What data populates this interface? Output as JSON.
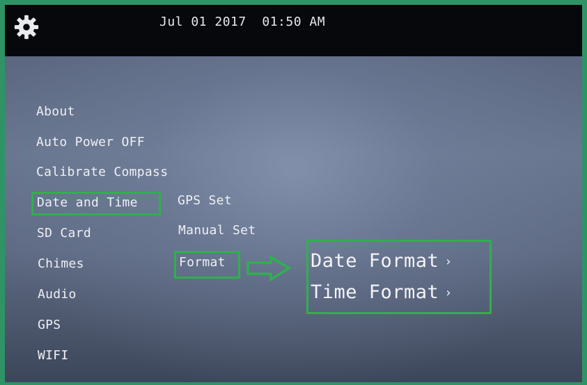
{
  "header": {
    "settings_icon": "gear-icon",
    "datetime": "Jul 01 2017  01:50 AM"
  },
  "menu": {
    "items": [
      {
        "label": "About"
      },
      {
        "label": "Auto Power OFF"
      },
      {
        "label": "Calibrate Compass"
      },
      {
        "label": "Date and Time",
        "highlighted": true
      },
      {
        "label": "SD Card"
      },
      {
        "label": "Chimes"
      },
      {
        "label": "Audio"
      },
      {
        "label": "GPS"
      },
      {
        "label": "WIFI"
      }
    ]
  },
  "submenu": {
    "items": [
      {
        "label": "GPS Set"
      },
      {
        "label": "Manual Set"
      },
      {
        "label": "Format",
        "highlighted": true
      }
    ]
  },
  "format_options": {
    "items": [
      {
        "label": "Date Format",
        "chevron": "›"
      },
      {
        "label": "Time Format",
        "chevron": "›"
      }
    ]
  },
  "colors": {
    "highlight": "#2fb04f",
    "frame": "#2e9466",
    "topbar": "#07080b"
  },
  "annotation_icons": {
    "arrow": "right-arrow-icon"
  }
}
